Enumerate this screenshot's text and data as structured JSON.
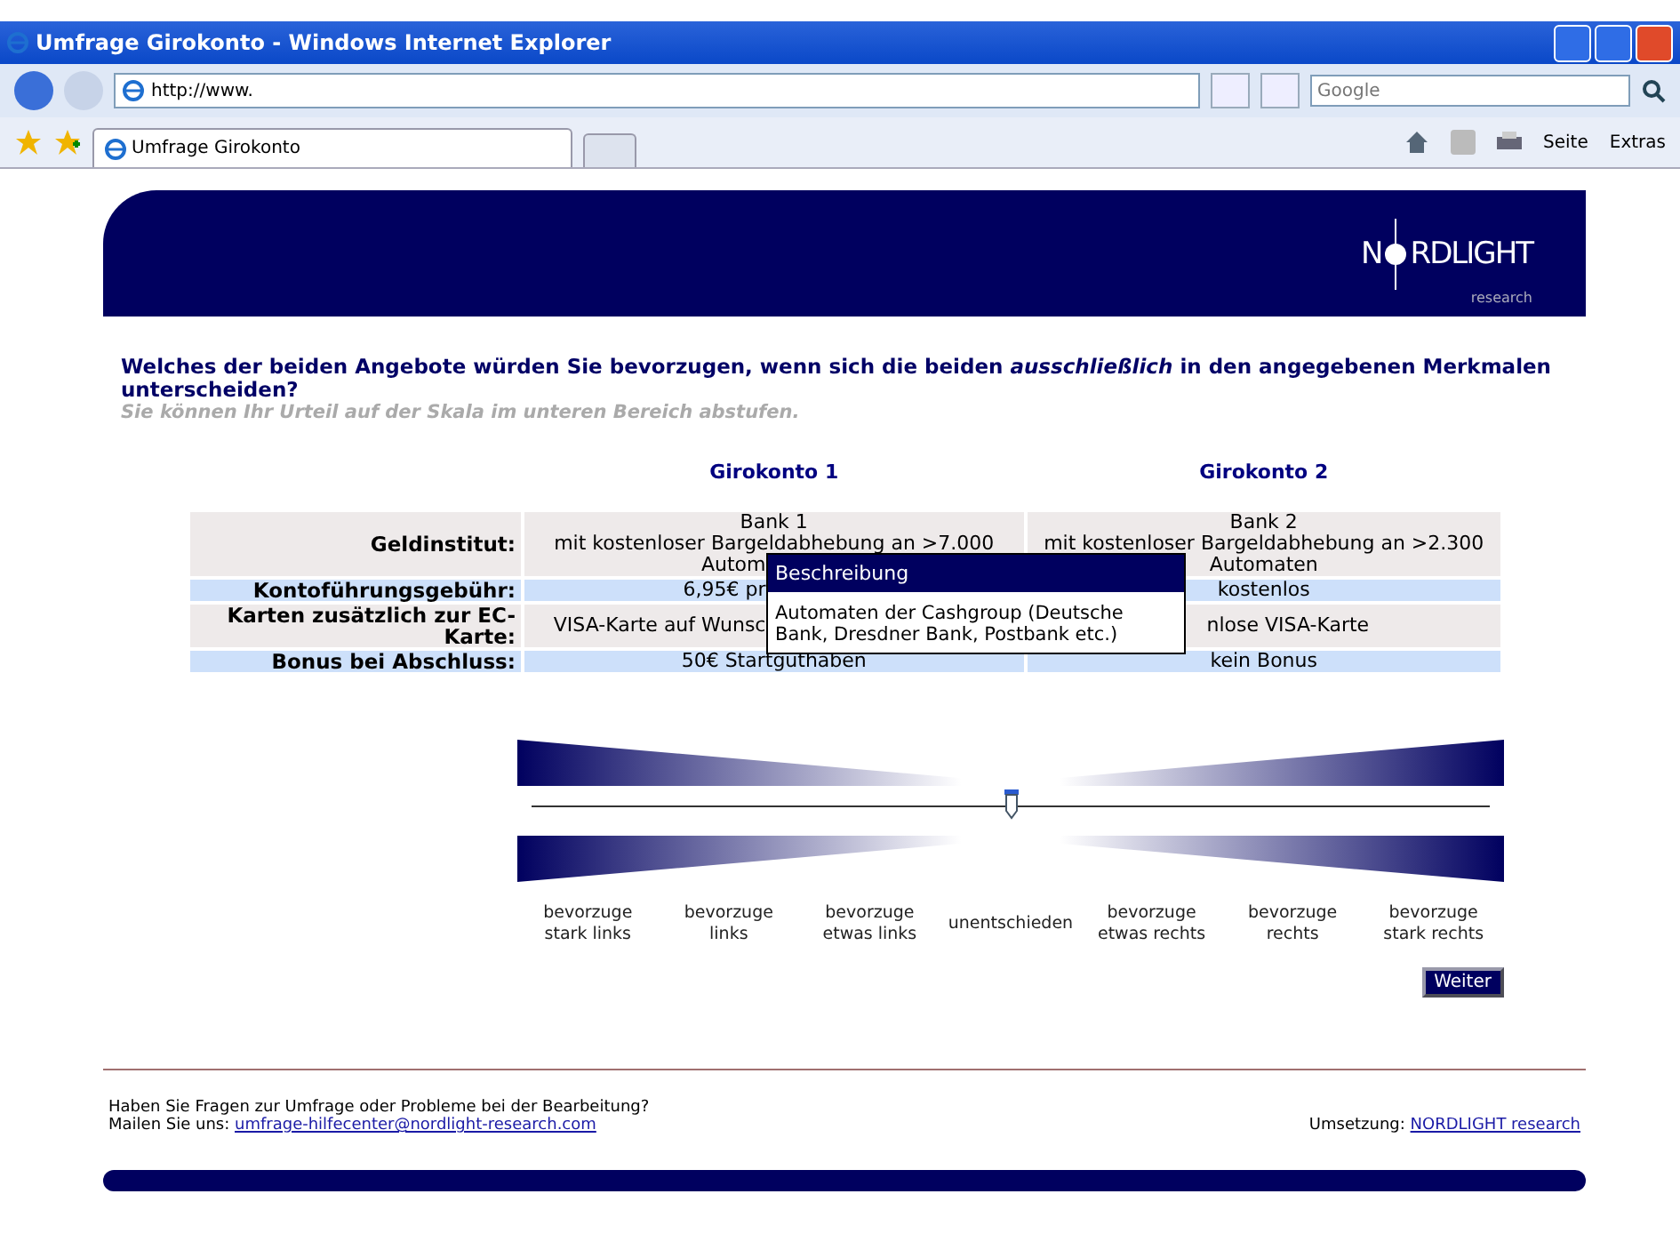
{
  "window": {
    "title": "Umfrage Girokonto - Windows Internet Explorer"
  },
  "address_bar": {
    "url": "http://www.",
    "search_placeholder": "Google"
  },
  "tabs": [
    {
      "label": "Umfrage Girokonto",
      "selected": true
    }
  ],
  "toolbar": {
    "items": [
      "Seite",
      "Extras"
    ]
  },
  "logo": {
    "left": "N",
    "right": "RDLIGHT",
    "sub": "research"
  },
  "question": {
    "text": "Welches der beiden Angebote würden Sie bevorzugen, wenn sich die beiden *ausschließlich* in den angegebenen Merkmalen unterscheiden?",
    "hint": "Sie können Ihr Urteil auf der Skala im unteren Bereich abstufen."
  },
  "table": {
    "columns": [
      "Girokonto 1",
      "Girokonto 2"
    ],
    "rows": [
      {
        "label": "Geldinstitut:",
        "cells": [
          [
            {
              "text": "Bank 1",
              "cut": false
            },
            {
              "text": "mit kostenloser Bargeldabhebung an >7.000",
              "cut": false
            },
            {
              "text": "Autom",
              "cut": true
            }
          ],
          [
            {
              "text": "Bank 2",
              "cut": false
            },
            {
              "text": "mit kostenloser Bargeldabhebung an >2.300",
              "cut": false
            },
            {
              "text": "Automaten",
              "cut": false
            }
          ]
        ]
      },
      {
        "label": "Kontoführungsgebühr:",
        "cells": [
          [
            {
              "text": "6,95€ pr",
              "cut": true
            }
          ],
          [
            {
              "text": "kostenlos",
              "cut": false
            }
          ]
        ]
      },
      {
        "label": "Karten zusätzlich zur EC-Karte:",
        "cells": [
          [
            {
              "text": "VISA-Karte auf Wunsc",
              "cut": true
            }
          ],
          [
            {
              "text": "nlose VISA-Karte",
              "cut": true
            }
          ]
        ]
      },
      {
        "label": "Bonus bei Abschluss:",
        "cells": [
          [
            {
              "text": "50€ Startguthaben",
              "cut": false
            }
          ],
          [
            {
              "text": "kein Bonus",
              "cut": false
            }
          ]
        ]
      }
    ]
  },
  "tooltip": {
    "title": "Beschreibung",
    "text": "Automaten der Cashgroup (Deutsche Bank, Dresdner Bank, Postbank etc.)"
  },
  "scale": {
    "level": 0.5,
    "labels": [
      "bevorzuge stark links",
      "bevorzuge links",
      "bevorzuge etwas links",
      "unentschieden",
      "bevorzuge etwas rechts",
      "bevorzuge rechts",
      "bevorzuge stark rechts"
    ]
  },
  "next_button": "Weiter",
  "footer": {
    "question": "Haben Sie Fragen zur Umfrage oder Probleme bei der Bearbeitung?",
    "mail_label": "Mailen Sie uns:",
    "mail": "umfrage-hilfecenter@nordlight-research.com",
    "credit_label": "Umsetzung:",
    "credit_link": "NORDLIGHT research"
  }
}
